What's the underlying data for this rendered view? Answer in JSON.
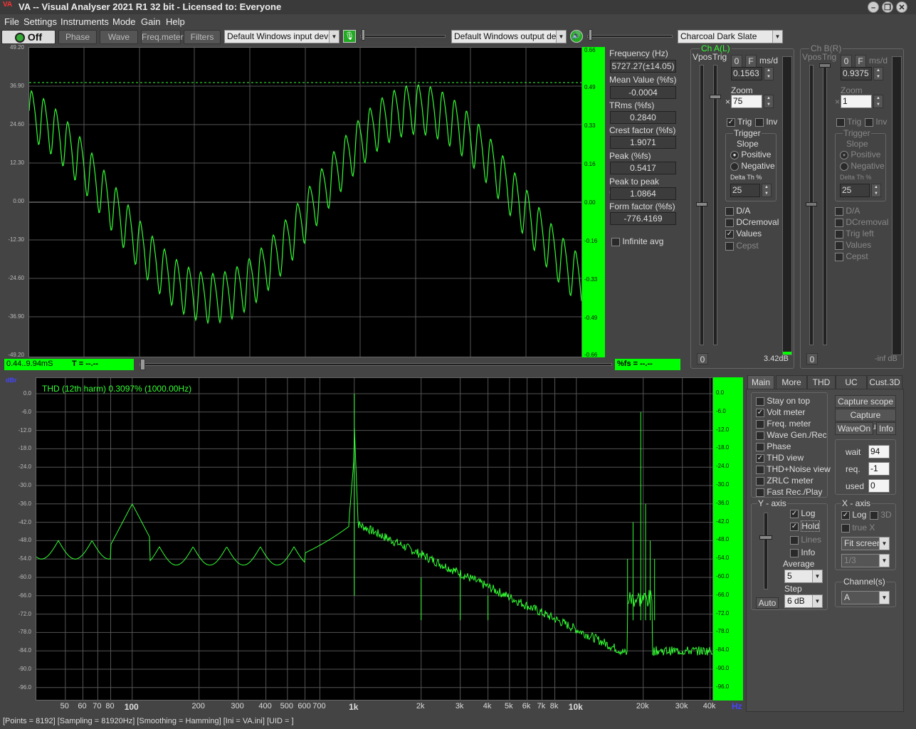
{
  "app": {
    "title": "VA -- Visual Analyser 2021 R1 32 bit - Licensed to: Everyone",
    "logo": "VA"
  },
  "window_buttons": [
    "minimize-icon",
    "restore-icon",
    "close-icon"
  ],
  "menu": [
    "File",
    "Settings",
    "Instruments",
    "Mode",
    "Gain",
    "Help"
  ],
  "toolbar": {
    "power_label": "Off",
    "buttons": [
      "Phase",
      "Wave",
      "Freq.meter",
      "Filters"
    ],
    "input_device": "Default Windows input device",
    "output_device": "Default Windows output devic",
    "theme": "Charcoal Dark Slate"
  },
  "scope": {
    "left_ticks": [
      "49.20",
      "36.90",
      "24.60",
      "12.30",
      "0.00",
      "-12.30",
      "-24.60",
      "-36.90",
      "-49.20"
    ],
    "right_ticks": [
      "0.66",
      "0.49",
      "0.33",
      "0.16",
      "0.00",
      "-0.16",
      "-0.33",
      "-0.49",
      "-0.66"
    ],
    "time_range": "0.44..9.94mS",
    "t_readout": "T = --.--",
    "fs_readout": "%fs = --.--"
  },
  "measurements": [
    {
      "label": "Frequency (Hz)",
      "value": "5727.27(±14.05)"
    },
    {
      "label": "Mean Value (%fs)",
      "value": "-0.0004"
    },
    {
      "label": "TRms (%fs)",
      "value": "0.2840"
    },
    {
      "label": "Crest factor (%fs)",
      "value": "1.9071"
    },
    {
      "label": "Peak (%fs)",
      "value": "0.5417"
    },
    {
      "label": "Peak to peak (%fs)",
      "value": "1.0864"
    },
    {
      "label": "Form factor (%fs)",
      "value": "-776.4169"
    }
  ],
  "infinite_avg": "Infinite avg",
  "cha": {
    "title": "Ch A(L)",
    "vpos": "Vpos",
    "trig": "Trig",
    "zero": "0",
    "f": "F",
    "msd": "ms/d",
    "msd_value": "0.1563",
    "zoom_label": "Zoom",
    "zoom_x": "×",
    "zoom_value": "75",
    "trig_cb": "Trig",
    "inv_cb": "Inv",
    "trigger": "Trigger",
    "slope": "Slope",
    "positive": "Positive",
    "negative": "Negative",
    "delta": "Delta Th %",
    "delta_value": "25",
    "options": [
      {
        "label": "D/A",
        "checked": false
      },
      {
        "label": "DCremoval",
        "checked": false
      },
      {
        "label": "Values",
        "checked": true
      },
      {
        "label": "Cepst",
        "checked": false
      }
    ],
    "bottom_zero": "0",
    "level": "3.42dB"
  },
  "chb": {
    "title": "Ch B(R)",
    "vpos": "Vpos",
    "trig": "Trig",
    "zero": "0",
    "f": "F",
    "msd": "ms/d",
    "msd_value": "0.9375",
    "zoom_label": "Zoom",
    "zoom_x": "×",
    "zoom_value": "1",
    "trig_cb": "Trig",
    "inv_cb": "Inv",
    "trigger": "Trigger",
    "slope": "Slope",
    "positive": "Positive",
    "negative": "Negative",
    "delta": "Delta Th %",
    "delta_value": "25",
    "options": [
      {
        "label": "D/A"
      },
      {
        "label": "DCremoval"
      },
      {
        "label": "Trig left"
      },
      {
        "label": "Values"
      },
      {
        "label": "Cepst"
      }
    ],
    "bottom_zero": "0",
    "level": "-inf dB"
  },
  "spectrum": {
    "unit": "dBr",
    "thd_text": "THD (12th harm) 0.3097% (1000.00Hz)",
    "y_ticks": [
      "0.0",
      "-6.0",
      "-12.0",
      "-18.0",
      "-24.0",
      "-30.0",
      "-36.0",
      "-42.0",
      "-48.0",
      "-54.0",
      "-60.0",
      "-66.0",
      "-72.0",
      "-78.0",
      "-84.0",
      "-90.0",
      "-96.0"
    ],
    "x_ticks": [
      "50",
      "60",
      "70",
      "80",
      "100",
      "200",
      "300",
      "400",
      "500",
      "600",
      "700",
      "1k",
      "2k",
      "3k",
      "4k",
      "5k",
      "6k",
      "7k",
      "8k",
      "10k",
      "20k",
      "30k",
      "40k"
    ],
    "hz": "Hz"
  },
  "tabs": [
    "Main",
    "More",
    "THD",
    "UC",
    "Cust.3D"
  ],
  "main_tab": {
    "checks": [
      {
        "label": "Stay on top",
        "checked": false
      },
      {
        "label": "Volt meter",
        "checked": true
      },
      {
        "label": "Freq. meter",
        "checked": false
      },
      {
        "label": "Wave Gen./Rec",
        "checked": false
      },
      {
        "label": "Phase",
        "checked": false
      },
      {
        "label": "THD view",
        "checked": true
      },
      {
        "label": "THD+Noise view",
        "checked": false
      },
      {
        "label": "ZRLC meter",
        "checked": false
      },
      {
        "label": "Fast Rec./Play",
        "checked": false
      }
    ],
    "capture_scope": "Capture scope",
    "capture_spectrum": "Capture spectrum",
    "waveon": "WaveOn",
    "info": "Info",
    "wait_label": "wait",
    "wait": "94",
    "req_label": "req.",
    "req": "-1",
    "used_label": "used",
    "used": "0",
    "yaxis": {
      "title": "Y - axis",
      "log": "Log",
      "hold": "Hold",
      "lines": "Lines",
      "info": "Info",
      "average": "Average",
      "average_value": "5",
      "step": "Step",
      "step_value": "6 dB",
      "auto": "Auto"
    },
    "xaxis": {
      "title": "X - axis",
      "log": "Log",
      "threed": "3D",
      "truex": "true X",
      "fit": "Fit screen",
      "oct": "1/3"
    },
    "channels": {
      "title": "Channel(s)",
      "value": "A"
    }
  },
  "status": "[Points = 8192]  [Sampling = 81920Hz]  [Smoothing = Hamming]  [Ini = VA.ini]  [UID = ]"
}
